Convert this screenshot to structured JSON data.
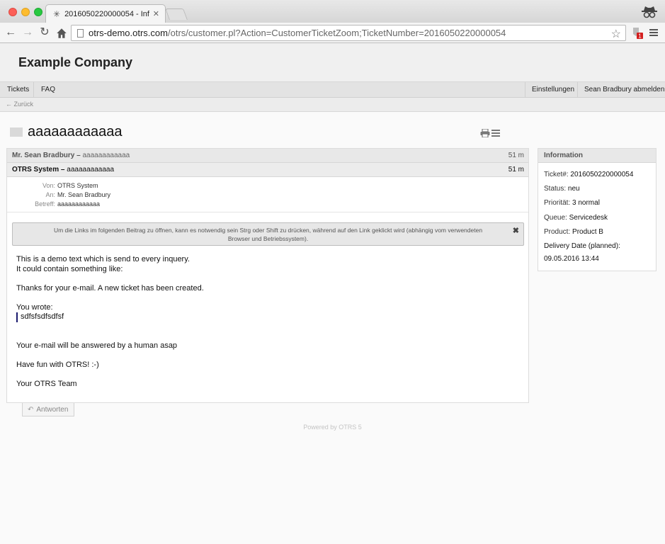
{
  "browser": {
    "tab_title": "2016050220000054 - Inf",
    "url_prefix": "otrs-demo.otrs.com",
    "url_rest": "/otrs/customer.pl?Action=CustomerTicketZoom;TicketNumber=2016050220000054",
    "extension_badge": "1"
  },
  "header": {
    "company": "Example Company"
  },
  "nav": {
    "tickets": "Tickets",
    "faq": "FAQ",
    "settings": "Einstellungen",
    "logout": "Sean Bradbury abmelden"
  },
  "back": "← Zurück",
  "ticket": {
    "title": "aaaaaaaaaaaa"
  },
  "articles": [
    {
      "from": "Mr. Sean Bradbury",
      "subject": "aaaaaaaaaaaa",
      "age": "51 m"
    },
    {
      "from": "OTRS System",
      "subject": "aaaaaaaaaaaa",
      "age": "51 m"
    }
  ],
  "meta": {
    "from_label": "Von:",
    "from": "OTRS System",
    "to_label": "An:",
    "to": "Mr. Sean Bradbury",
    "subject_label": "Betreff:",
    "subject": "aaaaaaaaaaaa"
  },
  "notice": {
    "line1": "Um die Links im folgenden Beitrag zu öffnen, kann es notwendig sein Strg oder Shift zu drücken, während auf den Link geklickt wird (abhängig vom verwendeten",
    "line2": "Browser und Betriebssystem).",
    "close": "✖"
  },
  "body": {
    "l1": "This is a demo text which is send to every inquery.",
    "l2": "It could contain something like:",
    "l3": "Thanks for your e-mail. A new ticket has been created.",
    "l4": "You wrote:",
    "quote": "sdfsfsdfsdfsf",
    "l5": "Your e-mail will be answered by a human asap",
    "l6": "Have fun with OTRS! :-)",
    "l7": "Your OTRS Team"
  },
  "reply": "Antworten",
  "footer": "Powered by OTRS 5",
  "info": {
    "heading": "Information",
    "ticket_label": "Ticket#:",
    "ticket": "2016050220000054",
    "status_label": "Status:",
    "status": "neu",
    "priority_label": "Priorität:",
    "priority": "3 normal",
    "queue_label": "Queue:",
    "queue": "Servicedesk",
    "product_label": "Product:",
    "product": "Product B",
    "delivery_label": "Delivery Date (planned):",
    "delivery": "09.05.2016 13:44"
  }
}
